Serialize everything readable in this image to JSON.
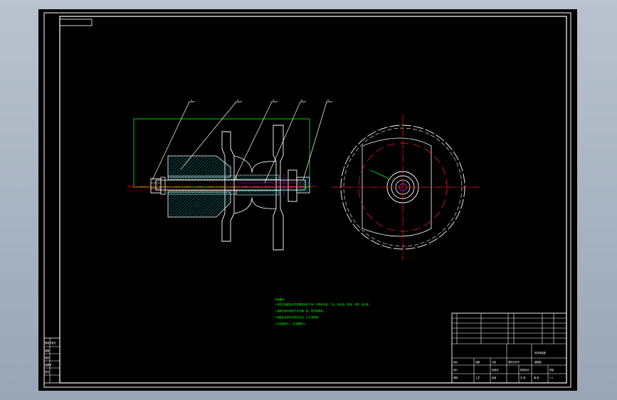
{
  "colors": {
    "desktop": "#a8b3c1",
    "background": "#000000",
    "frame": "#ffffff",
    "outline": "#ffffff",
    "hatch": "#00c8c8",
    "centerline": "#ff1e1e",
    "leader": "#ffffff",
    "construction": "#00ff00",
    "notes": "#00ff00",
    "hidden": "#ff00ff"
  },
  "drawing": {
    "balloons": [
      {
        "id": "balloon-1",
        "label": "1"
      },
      {
        "id": "balloon-2",
        "label": "2"
      },
      {
        "id": "balloon-3",
        "label": "3"
      },
      {
        "id": "balloon-4",
        "label": "4"
      },
      {
        "id": "balloon-5",
        "label": "5"
      }
    ],
    "technical_notes": {
      "heading": "技术要求",
      "lines": [
        "1.零件在装配前必须清理和清洗干净，不得有毛刺、飞边、氧化皮、锈蚀、切屑、油污等。",
        "2.装配过程中零件不允许磕、碰、划伤和锈蚀。",
        "3.装配后各部件应转动灵活，无卡滞现象。",
        "4.未注倒角C1，未注圆角R1。"
      ]
    },
    "title_block": {
      "title": "夹具体装配",
      "subtitle": "装配图",
      "rows": [
        [
          "标记",
          "处数",
          "分区",
          "更改文件号",
          "签名",
          "年月日"
        ],
        [
          "设计",
          "",
          "标准化",
          "",
          "阶段标记",
          "重量"
        ],
        [
          "审核",
          "",
          "",
          "",
          "",
          "1:1"
        ],
        [
          "工艺",
          "",
          "批准",
          "",
          "共 张",
          "第 张"
        ]
      ]
    },
    "side_labels": [
      "借用件登记",
      "描图",
      "描校",
      "底图号",
      "签字"
    ]
  }
}
